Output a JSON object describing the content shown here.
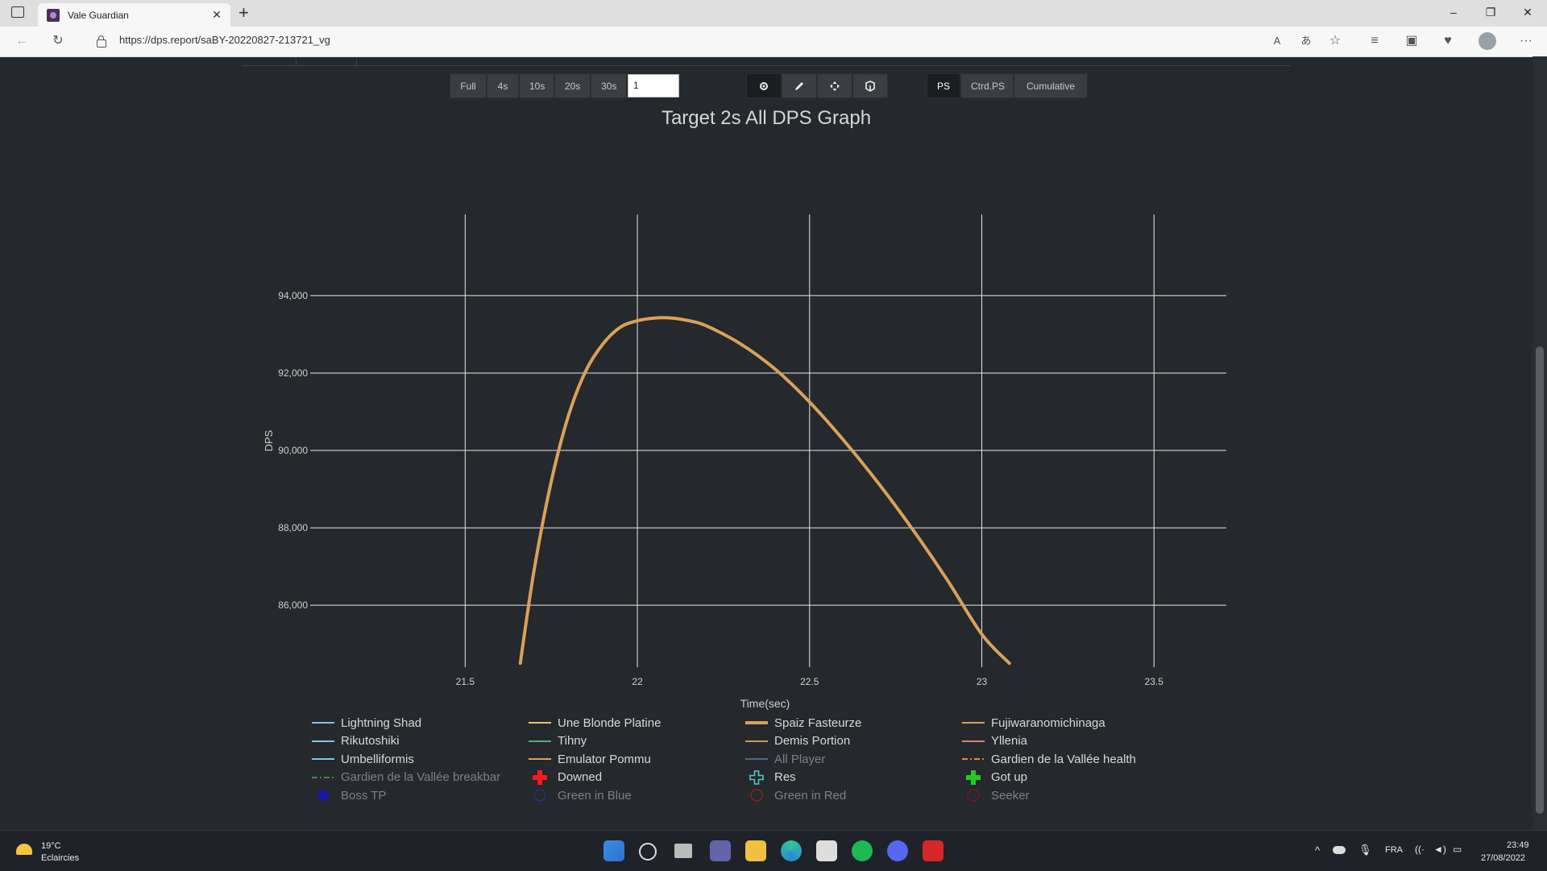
{
  "browser": {
    "tab_title": "Vale Guardian",
    "close_tab": "✕",
    "new_tab": "+",
    "url": "https://dps.report/saBY-20220827-213721_vg",
    "window_minimize": "–",
    "window_restore": "❐",
    "window_close": "✕"
  },
  "toolbar": {
    "range_buttons": [
      "Full",
      "4s",
      "10s",
      "20s",
      "30s"
    ],
    "smoothing_value": "1",
    "mode_buttons": [
      "PS",
      "Ctrd.PS",
      "Cumulative"
    ],
    "active_mode": "PS"
  },
  "chart_data": {
    "type": "line",
    "title": "Target 2s All DPS Graph",
    "xlabel": "Time(sec)",
    "ylabel": "DPS",
    "xlim": [
      21.05,
      23.71
    ],
    "ylim": [
      84400,
      96100
    ],
    "x_ticks": [
      21.5,
      22,
      22.5,
      23,
      23.5
    ],
    "x_tick_labels": [
      "21.5",
      "22",
      "22.5",
      "23",
      "23.5"
    ],
    "y_ticks": [
      86000,
      88000,
      90000,
      92000,
      94000
    ],
    "y_tick_labels": [
      "86,000",
      "88,000",
      "90,000",
      "92,000",
      "94,000"
    ],
    "grid": true,
    "series": [
      {
        "name": "Spaiz Fasteurze",
        "color": "#d9a15a",
        "x": [
          21.66,
          21.7,
          21.75,
          21.8,
          21.85,
          21.9,
          21.95,
          22.0,
          22.05,
          22.1,
          22.15,
          22.2,
          22.3,
          22.4,
          22.5,
          22.6,
          22.7,
          22.8,
          22.9,
          23.0,
          23.08
        ],
        "y": [
          84500,
          86900,
          89200,
          90900,
          92050,
          92750,
          93180,
          93350,
          93420,
          93420,
          93350,
          93220,
          92750,
          92100,
          91250,
          90250,
          89150,
          87950,
          86650,
          85250,
          84500
        ]
      }
    ]
  },
  "legend": [
    {
      "label": "Lightning Shad",
      "color": "#7ec8e3",
      "style": "line"
    },
    {
      "label": "Une Blonde Platine",
      "color": "#e0c76a",
      "style": "line"
    },
    {
      "label": "Spaiz Fasteurze",
      "color": "#d9a15a",
      "style": "thick"
    },
    {
      "label": "Fujiwaranomichinaga",
      "color": "#d9a15a",
      "style": "line"
    },
    {
      "label": "Rikutoshiki",
      "color": "#7ec8e3",
      "style": "line"
    },
    {
      "label": "Tihny",
      "color": "#4caf7a",
      "style": "line"
    },
    {
      "label": "Demis Portion",
      "color": "#c99a5a",
      "style": "line"
    },
    {
      "label": "Yllenia",
      "color": "#e08080",
      "style": "line"
    },
    {
      "label": "Umbelliformis",
      "color": "#7ec8e3",
      "style": "line"
    },
    {
      "label": "Emulator Pommu",
      "color": "#d9a15a",
      "style": "line"
    },
    {
      "label": "All Player",
      "color": "#4a6a8a",
      "style": "line",
      "dim": true
    },
    {
      "label": "Gardien de la Vallée health",
      "color": "#e6892f",
      "style": "dashdot"
    },
    {
      "label": "Gardien de la Vallée breakbar",
      "color": "#3a8a4a",
      "style": "dashdot",
      "dim": true
    },
    {
      "label": "Downed",
      "color": "#ff1a1a",
      "style": "cross"
    },
    {
      "label": "Res",
      "color": "#4ec9c9",
      "style": "crossopen"
    },
    {
      "label": "Got up",
      "color": "#22cc22",
      "style": "cross"
    },
    {
      "label": "Boss TP",
      "color": "#1a1aa0",
      "style": "dot",
      "dim": true
    },
    {
      "label": "Green in Blue",
      "color": "#1a3a7a",
      "style": "circle",
      "dim": true
    },
    {
      "label": "Green in Red",
      "color": "#7a2a1a",
      "style": "circle",
      "dim": true
    },
    {
      "label": "Seeker",
      "color": "#6a1a2a",
      "style": "circle",
      "dim": true
    }
  ],
  "taskbar": {
    "weather_temp": "19°C",
    "weather_desc": "Eclaircies",
    "language": "FRA",
    "time": "23:49",
    "date": "27/08/2022"
  }
}
